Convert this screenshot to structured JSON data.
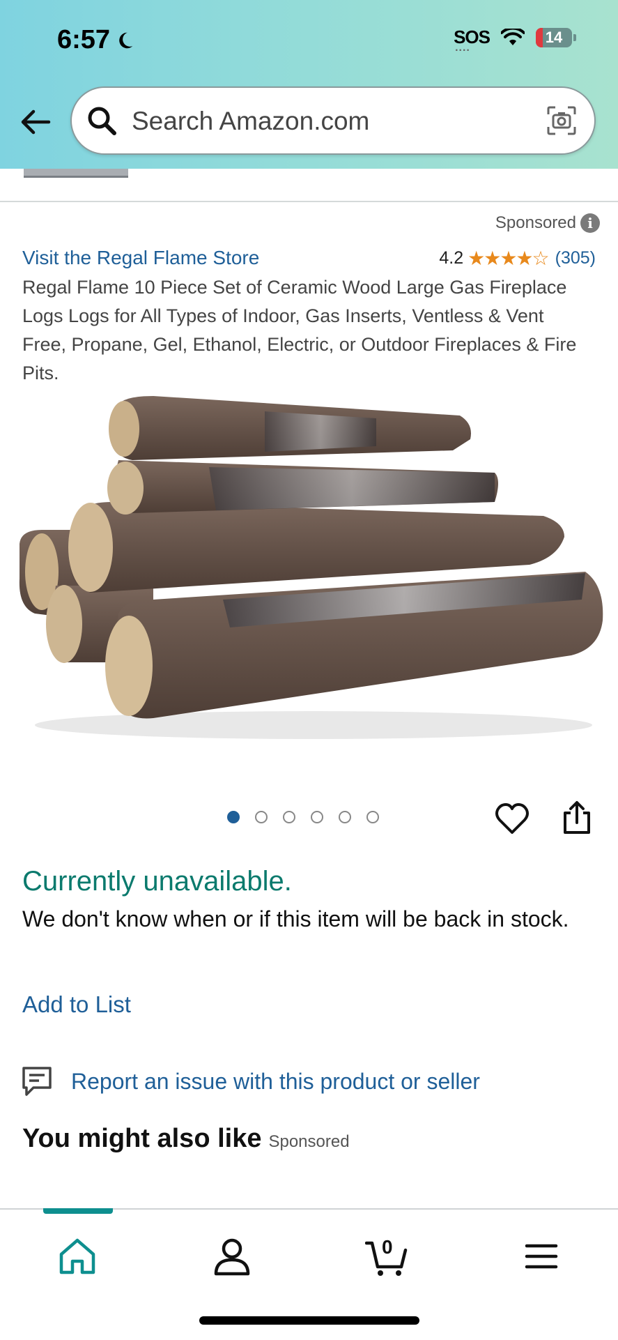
{
  "status_bar": {
    "time": "6:57",
    "sos": "SOS",
    "battery": "14"
  },
  "search": {
    "placeholder": "Search Amazon.com"
  },
  "listing": {
    "sponsored_label": "Sponsored",
    "store_link": "Visit the Regal Flame Store",
    "rating": "4.2",
    "stars": "★★★★☆",
    "review_count": "(305)",
    "title": "Regal Flame 10 Piece Set of Ceramic Wood Large Gas Fireplace Logs Logs for All Types of Indoor, Gas Inserts, Ventless & Vent Free, Propane, Gel, Ethanol, Electric, or Outdoor Fireplaces & Fire Pits.",
    "image_count": 6,
    "active_image": 1
  },
  "availability": {
    "status": "Currently unavailable.",
    "message": "We don't know when or if this item will be back in stock."
  },
  "actions": {
    "add_to_list": "Add to List",
    "report": "Report an issue with this product or seller"
  },
  "recommendations": {
    "heading": "You might also like",
    "sponsored": "Sponsored"
  },
  "bottom_nav": {
    "items": [
      "home",
      "account",
      "cart",
      "menu"
    ],
    "active": "home",
    "cart_count": "0"
  },
  "colors": {
    "header_gradient_start": "#7fd3e0",
    "header_gradient_end": "#a8e2cf",
    "link": "#1f5f98",
    "unavailable": "#0b7a6d",
    "star": "#e8891c",
    "nav_active": "#0e8f8f"
  }
}
